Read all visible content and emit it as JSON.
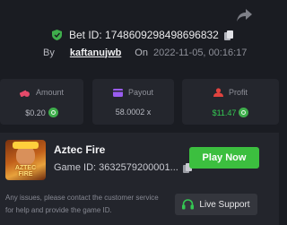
{
  "header": {
    "share_icon": "share-arrow-icon",
    "verified_icon": "shield-check-icon",
    "verified_color": "#3fae4c",
    "bet_id_label": "Bet ID:",
    "bet_id": "1748609298498696832",
    "copy_icon": "copy-icon",
    "by_label": "By",
    "username": "kaftanujwb",
    "on_label": "On",
    "timestamp": "2022-11-05, 00:16:17"
  },
  "stats": [
    {
      "label": "Amount",
      "value": "$0.20",
      "icon": "money-stack-icon",
      "icon_color": "#e44a6a",
      "coin_icon": "coin-icon"
    },
    {
      "label": "Payout",
      "value": "58.0002 x",
      "icon": "card-icon",
      "icon_color": "#9a5cf0"
    },
    {
      "label": "Profit",
      "value": "$11.47",
      "icon": "chart-bars-icon",
      "icon_color": "#e0433f",
      "value_color": "#34c852",
      "coin_icon": "coin-icon"
    }
  ],
  "game": {
    "thumbnail_icon": "aztec-fire-thumbnail",
    "thumbnail_text": "AZTEC FIRE",
    "name": "Aztec Fire",
    "id_text": "Game ID: 3632579200001...",
    "play_label": "Play Now",
    "play_color": "#3cbf3f",
    "info": "Any issues, please contact the customer service for help and provide the game ID.",
    "support_label": "Live Support",
    "support_icon": "headset-icon",
    "support_icon_color": "#34c852"
  }
}
